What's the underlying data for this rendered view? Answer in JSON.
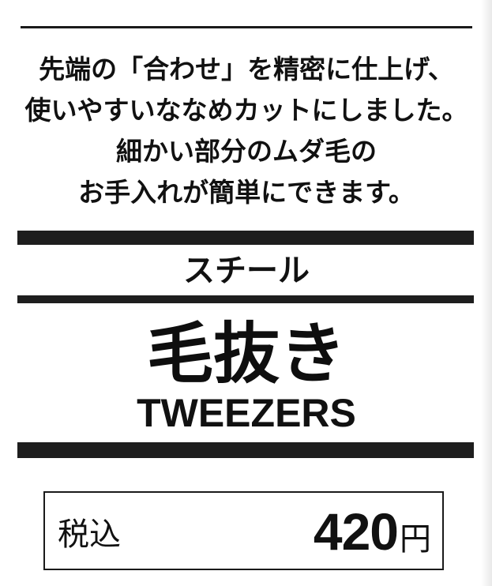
{
  "description": {
    "lines": [
      "先端の「合わせ」を精密に仕上げ、",
      "使いやすいななめカットにしました。",
      "細かい部分のムダ毛の",
      "お手入れが簡単にできます。"
    ]
  },
  "product": {
    "material": "スチール",
    "name_jp": "毛抜き",
    "name_en": "TWEEZERS"
  },
  "price": {
    "tax_label": "税込",
    "amount": "420",
    "unit": "円"
  },
  "colors": {
    "ink": "#111111",
    "bars": "#1e1e1e",
    "paper": "#ffffff"
  }
}
